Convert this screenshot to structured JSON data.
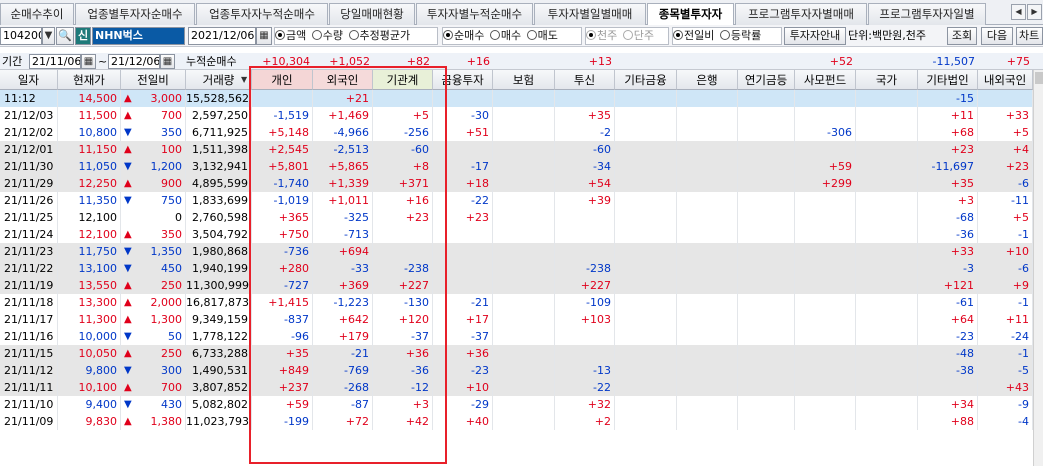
{
  "tabs": [
    {
      "label": "순매수추이",
      "active": false
    },
    {
      "label": "업종별투자자순매수",
      "active": false
    },
    {
      "label": "업종투자자누적순매수",
      "active": false
    },
    {
      "label": "당일매매현황",
      "active": false
    },
    {
      "label": "투자자별누적순매수",
      "active": false
    },
    {
      "label": "투자자별일별매매",
      "active": false
    },
    {
      "label": "종목별투자자",
      "active": true
    },
    {
      "label": "프로그램투자자별매매",
      "active": false
    },
    {
      "label": "프로그램투자자일별",
      "active": false
    }
  ],
  "controls": {
    "stock_code": "104200",
    "credit_badge": "신",
    "stock_name": "NHN벅스",
    "date": "2021/12/06",
    "unit_group": [
      {
        "label": "금액",
        "checked": true
      },
      {
        "label": "수량",
        "checked": false
      },
      {
        "label": "추정평균가",
        "checked": false
      }
    ],
    "trade_group": [
      {
        "label": "순매수",
        "checked": true
      },
      {
        "label": "매수",
        "checked": false
      },
      {
        "label": "매도",
        "checked": false
      }
    ],
    "price_unit_group": [
      {
        "label": "천주",
        "checked": true
      },
      {
        "label": "단주",
        "checked": false
      }
    ],
    "compare_group": [
      {
        "label": "전일비",
        "checked": true
      },
      {
        "label": "등락률",
        "checked": false
      }
    ],
    "investor_info_button": "투자자안내",
    "unit_text": "단위:백만원,천주",
    "query_button": "조회",
    "next_button": "다음",
    "chart_button": "차트"
  },
  "period": {
    "label": "기간",
    "start": "21/11/06",
    "separator": "~",
    "end": "21/12/06",
    "cumulative_label": "누적순매수",
    "cumulative": [
      "+10,304",
      "+1,052",
      "+82",
      "+16",
      "",
      "+13",
      "",
      "",
      "",
      "+52",
      "",
      "-11,507",
      "+75"
    ]
  },
  "headers": [
    "일자",
    "현재가",
    "전일비",
    "거래량",
    "개인",
    "외국인",
    "기관계",
    "금융투자",
    "보험",
    "투신",
    "기타금융",
    "은행",
    "연기금등",
    "사모펀드",
    "국가",
    "기타법인",
    "내외국인"
  ],
  "rows": [
    {
      "date": "11:12",
      "price": "14,500",
      "dir": "up",
      "change": "3,000",
      "volume": "15,528,562",
      "vals": [
        "",
        "+21",
        "",
        "",
        "",
        "",
        "",
        "",
        "",
        "",
        "",
        "-15",
        ""
      ]
    },
    {
      "date": "21/12/03",
      "price": "11,500",
      "dir": "up",
      "change": "700",
      "volume": "2,597,250",
      "vals": [
        "-1,519",
        "+1,469",
        "+5",
        "-30",
        "",
        "+35",
        "",
        "",
        "",
        "",
        "",
        "+11",
        "+33"
      ]
    },
    {
      "date": "21/12/02",
      "price": "10,800",
      "dir": "down",
      "change": "350",
      "volume": "6,711,925",
      "vals": [
        "+5,148",
        "-4,966",
        "-256",
        "+51",
        "",
        "-2",
        "",
        "",
        "",
        "-306",
        "",
        "+68",
        "+5"
      ]
    },
    {
      "date": "21/12/01",
      "price": "11,150",
      "dir": "up",
      "change": "100",
      "volume": "1,511,398",
      "vals": [
        "+2,545",
        "-2,513",
        "-60",
        "",
        "",
        "-60",
        "",
        "",
        "",
        "",
        "",
        "+23",
        "+4"
      ]
    },
    {
      "date": "21/11/30",
      "price": "11,050",
      "dir": "down",
      "change": "1,200",
      "volume": "3,132,941",
      "vals": [
        "+5,801",
        "+5,865",
        "+8",
        "-17",
        "",
        "-34",
        "",
        "",
        "",
        "+59",
        "",
        "-11,697",
        "+23"
      ]
    },
    {
      "date": "21/11/29",
      "price": "12,250",
      "dir": "up",
      "change": "900",
      "volume": "4,895,599",
      "vals": [
        "-1,740",
        "+1,339",
        "+371",
        "+18",
        "",
        "+54",
        "",
        "",
        "",
        "+299",
        "",
        "+35",
        "-6"
      ]
    },
    {
      "date": "21/11/26",
      "price": "11,350",
      "dir": "down",
      "change": "750",
      "volume": "1,833,699",
      "vals": [
        "-1,019",
        "+1,011",
        "+16",
        "-22",
        "",
        "+39",
        "",
        "",
        "",
        "",
        "",
        "+3",
        "-11"
      ]
    },
    {
      "date": "21/11/25",
      "price": "12,100",
      "dir": "none",
      "change": "0",
      "volume": "2,760,598",
      "vals": [
        "+365",
        "-325",
        "+23",
        "+23",
        "",
        "",
        "",
        "",
        "",
        "",
        "",
        "-68",
        "+5"
      ]
    },
    {
      "date": "21/11/24",
      "price": "12,100",
      "dir": "up",
      "change": "350",
      "volume": "3,504,792",
      "vals": [
        "+750",
        "-713",
        "",
        "",
        "",
        "",
        "",
        "",
        "",
        "",
        "",
        "-36",
        "-1"
      ]
    },
    {
      "date": "21/11/23",
      "price": "11,750",
      "dir": "down",
      "change": "1,350",
      "volume": "1,980,868",
      "vals": [
        "-736",
        "+694",
        "",
        "",
        "",
        "",
        "",
        "",
        "",
        "",
        "",
        "+33",
        "+10"
      ]
    },
    {
      "date": "21/11/22",
      "price": "13,100",
      "dir": "down",
      "change": "450",
      "volume": "1,940,199",
      "vals": [
        "+280",
        "-33",
        "-238",
        "",
        "",
        "-238",
        "",
        "",
        "",
        "",
        "",
        "-3",
        "-6"
      ]
    },
    {
      "date": "21/11/19",
      "price": "13,550",
      "dir": "up",
      "change": "250",
      "volume": "11,300,999",
      "vals": [
        "-727",
        "+369",
        "+227",
        "",
        "",
        "+227",
        "",
        "",
        "",
        "",
        "",
        "+121",
        "+9"
      ]
    },
    {
      "date": "21/11/18",
      "price": "13,300",
      "dir": "up",
      "change": "2,000",
      "volume": "16,817,873",
      "vals": [
        "+1,415",
        "-1,223",
        "-130",
        "-21",
        "",
        "-109",
        "",
        "",
        "",
        "",
        "",
        "-61",
        "-1"
      ]
    },
    {
      "date": "21/11/17",
      "price": "11,300",
      "dir": "up",
      "change": "1,300",
      "volume": "9,349,159",
      "vals": [
        "-837",
        "+642",
        "+120",
        "+17",
        "",
        "+103",
        "",
        "",
        "",
        "",
        "",
        "+64",
        "+11"
      ]
    },
    {
      "date": "21/11/16",
      "price": "10,000",
      "dir": "down",
      "change": "50",
      "volume": "1,778,122",
      "vals": [
        "-96",
        "+179",
        "-37",
        "-37",
        "",
        "",
        "",
        "",
        "",
        "",
        "",
        "-23",
        "-24"
      ]
    },
    {
      "date": "21/11/15",
      "price": "10,050",
      "dir": "up",
      "change": "250",
      "volume": "6,733,288",
      "vals": [
        "+35",
        "-21",
        "+36",
        "+36",
        "",
        "",
        "",
        "",
        "",
        "",
        "",
        "-48",
        "-1"
      ]
    },
    {
      "date": "21/11/12",
      "price": "9,800",
      "dir": "down",
      "change": "300",
      "volume": "1,490,531",
      "vals": [
        "+849",
        "-769",
        "-36",
        "-23",
        "",
        "-13",
        "",
        "",
        "",
        "",
        "",
        "-38",
        "-5"
      ]
    },
    {
      "date": "21/11/11",
      "price": "10,100",
      "dir": "up",
      "change": "700",
      "volume": "3,807,852",
      "vals": [
        "+237",
        "-268",
        "-12",
        "+10",
        "",
        "-22",
        "",
        "",
        "",
        "",
        "",
        "",
        "+43"
      ]
    },
    {
      "date": "21/11/10",
      "price": "9,400",
      "dir": "down",
      "change": "430",
      "volume": "5,082,802",
      "vals": [
        "+59",
        "-87",
        "+3",
        "-29",
        "",
        "+32",
        "",
        "",
        "",
        "",
        "",
        "+34",
        "-9"
      ]
    },
    {
      "date": "21/11/09",
      "price": "9,830",
      "dir": "up",
      "change": "1,380",
      "volume": "11,023,793",
      "vals": [
        "-199",
        "+72",
        "+42",
        "+40",
        "",
        "+2",
        "",
        "",
        "",
        "",
        "",
        "+88",
        "-4"
      ]
    }
  ],
  "colors": {
    "up": "#e0001b",
    "down": "#0037c8",
    "individual_header": "#f4d6d6",
    "foreign_header": "#f5dada",
    "institution_header": "#e8f0d8",
    "selected_row": "#cfe6f7",
    "gray_row": "#e6e6e6",
    "highlight_box": "#e8202a"
  }
}
